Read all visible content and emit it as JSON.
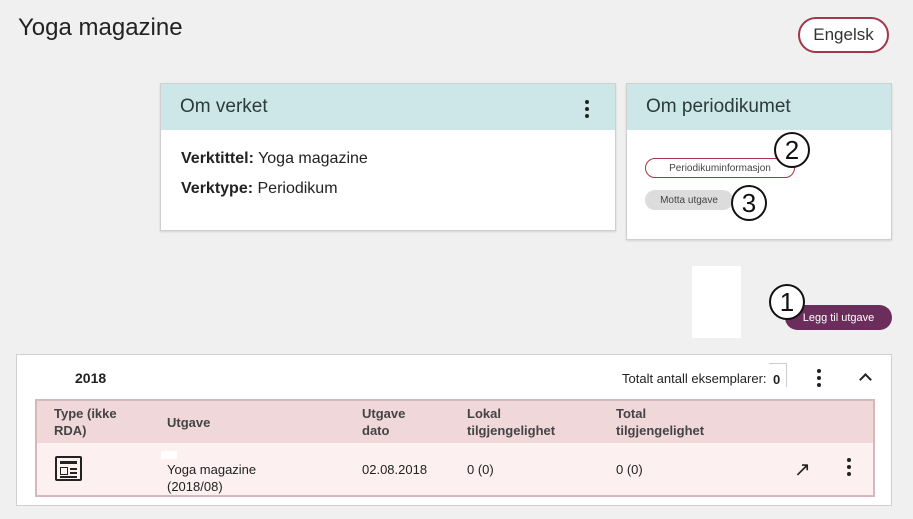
{
  "page_title": "Yoga magazine",
  "language_button": "Engelsk",
  "om_verket": {
    "title": "Om verket",
    "fields": [
      {
        "label": "Verktittel:",
        "value": "Yoga magazine"
      },
      {
        "label": "Verktype:",
        "value": "Periodikum"
      }
    ]
  },
  "om_periodikumet": {
    "title": "Om periodikumet",
    "info_pill": "Periodikuminformasjon",
    "motta_pill": "Motta utgave"
  },
  "annotations": [
    "1",
    "2",
    "3"
  ],
  "add_issue_button": "Legg til utgave",
  "year_panel": {
    "year": "2018",
    "total_label": "Totalt antall eksemplarer:",
    "total_value": "0",
    "columns": [
      "Type (ikke RDA)",
      "Utgave",
      "Utgave dato",
      "Lokal tilgjengelighet",
      "Total tilgjengelighet"
    ],
    "column_lines": [
      [
        "Type (ikke",
        "RDA)"
      ],
      [
        "Utgave"
      ],
      [
        "Utgave",
        "dato"
      ],
      [
        "Lokal",
        "tilgjengelighet"
      ],
      [
        "Total",
        "tilgjengelighet"
      ]
    ],
    "rows": [
      {
        "type_icon": "newspaper-icon",
        "utgave_lines": [
          "Yoga magazine",
          "(2018/08)"
        ],
        "dato": "02.08.2018",
        "lokal": "0 (0)",
        "total": "0 (0)"
      }
    ]
  }
}
